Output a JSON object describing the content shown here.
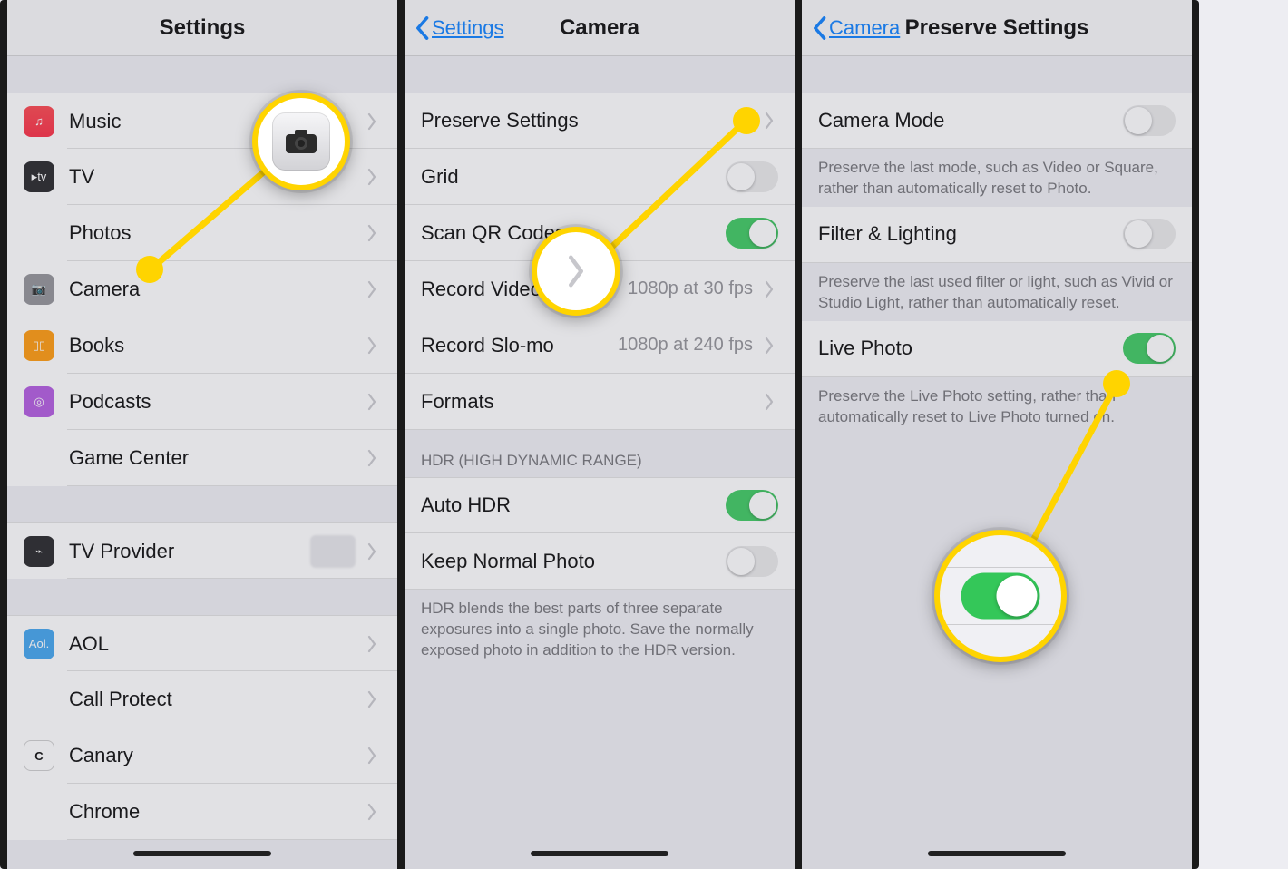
{
  "panel1": {
    "title": "Settings",
    "rowsTop": [
      {
        "id": "music",
        "label": "Music",
        "iconClass": "ic-music",
        "glyph": "♫"
      },
      {
        "id": "tv",
        "label": "TV",
        "iconClass": "ic-tv",
        "glyph": "▸tv"
      },
      {
        "id": "photos",
        "label": "Photos",
        "iconClass": "ic-photos",
        "glyph": "✿"
      },
      {
        "id": "camera",
        "label": "Camera",
        "iconClass": "ic-camera",
        "glyph": "📷"
      },
      {
        "id": "books",
        "label": "Books",
        "iconClass": "ic-books",
        "glyph": "▯▯"
      },
      {
        "id": "podcasts",
        "label": "Podcasts",
        "iconClass": "ic-podcasts",
        "glyph": "◎"
      },
      {
        "id": "gamecenter",
        "label": "Game Center",
        "iconClass": "ic-gc",
        "glyph": "●●"
      }
    ],
    "rowsMid": [
      {
        "id": "tvprovider",
        "label": "TV Provider",
        "iconClass": "ic-tvp",
        "glyph": "⌁",
        "blur": true
      }
    ],
    "rowsApps": [
      {
        "id": "aol",
        "label": "AOL",
        "iconClass": "ic-aol",
        "glyph": "Aol."
      },
      {
        "id": "callprotect",
        "label": "Call Protect",
        "iconClass": "ic-call",
        "glyph": "🛡"
      },
      {
        "id": "canary",
        "label": "Canary",
        "iconClass": "ic-canary",
        "glyph": "C"
      },
      {
        "id": "chrome",
        "label": "Chrome",
        "iconClass": "ic-chrome",
        "glyph": "◐"
      }
    ]
  },
  "panel2": {
    "back": "Settings",
    "title": "Camera",
    "group1": [
      {
        "id": "preserve",
        "label": "Preserve Settings",
        "type": "nav"
      },
      {
        "id": "grid",
        "label": "Grid",
        "type": "toggle",
        "on": false
      },
      {
        "id": "qr",
        "label": "Scan QR Codes",
        "type": "toggle",
        "on": true
      },
      {
        "id": "recvideo",
        "label": "Record Video",
        "type": "detail",
        "detail": "1080p at 30 fps"
      },
      {
        "id": "recslomo",
        "label": "Record Slo-mo",
        "type": "detail",
        "detail": "1080p at 240 fps"
      },
      {
        "id": "formats",
        "label": "Formats",
        "type": "nav"
      }
    ],
    "group2Header": "HDR (HIGH DYNAMIC RANGE)",
    "group2": [
      {
        "id": "autohdr",
        "label": "Auto HDR",
        "type": "toggle",
        "on": true
      },
      {
        "id": "keepnormal",
        "label": "Keep Normal Photo",
        "type": "toggle",
        "on": false
      }
    ],
    "group2Footer": "HDR blends the best parts of three separate exposures into a single photo. Save the normally exposed photo in addition to the HDR version."
  },
  "panel3": {
    "back": "Camera",
    "title": "Preserve Settings",
    "items": [
      {
        "id": "cameramode",
        "label": "Camera Mode",
        "on": false,
        "footer": "Preserve the last mode, such as Video or Square, rather than automatically reset to Photo."
      },
      {
        "id": "filterlight",
        "label": "Filter & Lighting",
        "on": false,
        "footer": "Preserve the last used filter or light, such as Vivid or Studio Light, rather than automatically reset."
      },
      {
        "id": "livephoto",
        "label": "Live Photo",
        "on": true,
        "footer": "Preserve the Live Photo setting, rather than automatically reset to Live Photo turned on."
      }
    ]
  }
}
